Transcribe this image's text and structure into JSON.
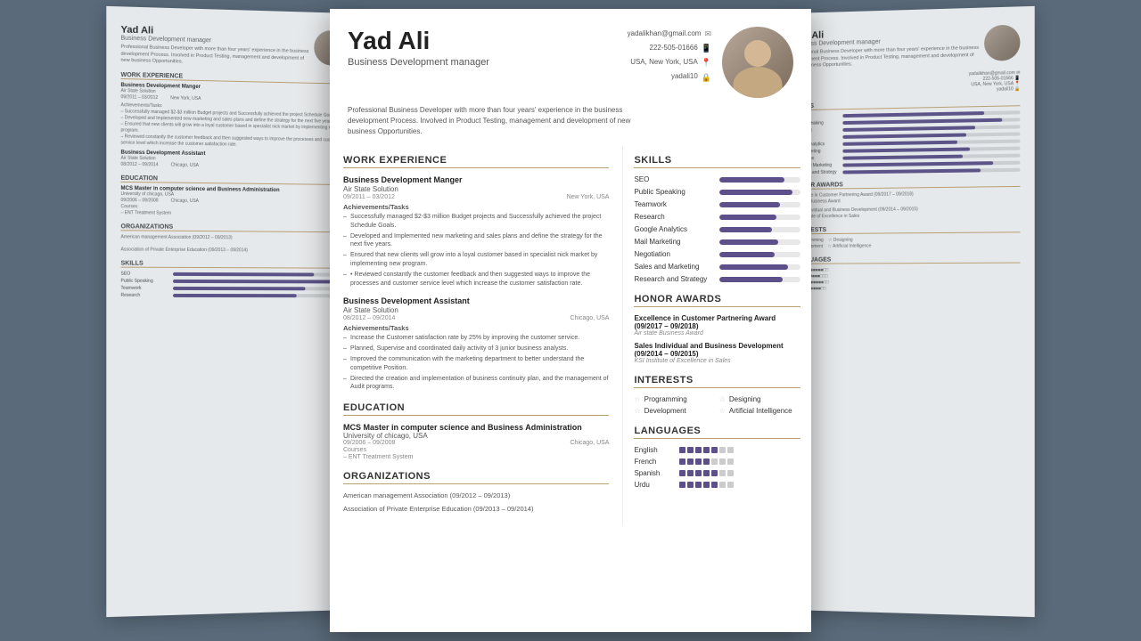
{
  "person": {
    "name": "Yad Ali",
    "title": "Business Development manager",
    "bio": "Professional Business Developer with more than four years' experience in the business development Process. Involved in Product Testing, management and development of new business Opportunities.",
    "contact": {
      "email": "yadalikhan@gmail.com",
      "phone": "222-505-01666",
      "location": "USA, New York, USA",
      "social": "yadali10"
    }
  },
  "workExperience": {
    "sectionTitle": "WORK EXPERIENCE",
    "jobs": [
      {
        "title": "Business Development Manger",
        "company": "Air State Solution",
        "dates": "09/2011 – 03/2012",
        "location": "New York, USA",
        "achievementsLabel": "Achievements/Tasks",
        "bullets": [
          "Successfully managed $2-$3 million Budget projects and Successfully achieved the project Schedule Goals.",
          "Developed and Implemented new marketing and sales plans and define the strategy for the next five years.",
          "Ensured that new clients will grow into a loyal customer based in specialist nick market by implementing new program.",
          "• Reviewed constantly the customer feedback and then suggested ways to improve the processes and customer service level which increase the customer satisfaction rate."
        ]
      },
      {
        "title": "Business Development Assistant",
        "company": "Air State Solution",
        "dates": "08/2012 – 09/2014",
        "location": "Chicago, USA",
        "achievementsLabel": "Achievements/Tasks",
        "bullets": [
          "Increase the Customer satisfaction rate by 25% by improving the customer service.",
          "Planned, Supervise and coordinated daily activity of 3 junior business analysts.",
          "Improved the communication with the marketing department to better understand the competitive Position.",
          "Directed the creation and implementation of business continuity plan, and the management of Audit programs."
        ]
      }
    ]
  },
  "education": {
    "sectionTitle": "EDUCATION",
    "entries": [
      {
        "degree": "MCS Master in computer science and Business Administration",
        "school": "University of chicago, USA",
        "dates": "09/2006 – 09/2008",
        "location": "Chicago, USA",
        "courseLabel": "Courses",
        "course": "– ENT Treatment System"
      }
    ]
  },
  "organizations": {
    "sectionTitle": "ORGANIZATIONS",
    "entries": [
      "American management Association (09/2012 – 09/2013)",
      "Association of Private Enterprise Education (09/2013 – 09/2014)"
    ]
  },
  "skills": {
    "sectionTitle": "SKILLS",
    "items": [
      {
        "name": "SEO",
        "percent": 80
      },
      {
        "name": "Public Speaking",
        "percent": 90
      },
      {
        "name": "Teamwork",
        "percent": 75
      },
      {
        "name": "Research",
        "percent": 70
      },
      {
        "name": "Google Analytics",
        "percent": 65
      },
      {
        "name": "Mail Marketing",
        "percent": 72
      },
      {
        "name": "Negotiation",
        "percent": 68
      },
      {
        "name": "Sales and Marketing",
        "percent": 85
      },
      {
        "name": "Research and Strategy",
        "percent": 78
      }
    ]
  },
  "honorAwards": {
    "sectionTitle": "HONOR AWARDS",
    "entries": [
      {
        "title": "Excellence in Customer Partnering Award (09/2017 – 09/2018)",
        "sub": "Air state Business Award"
      },
      {
        "title": "Sales Individual and Business Development (09/2014 – 09/2015)",
        "sub": "KSI Institute of Excellence in Sales"
      }
    ]
  },
  "interests": {
    "sectionTitle": "INTERESTS",
    "items": [
      "Programming",
      "Designing",
      "Development",
      "Artificial Intelligence"
    ]
  },
  "languages": {
    "sectionTitle": "LANGUAGES",
    "items": [
      {
        "name": "English",
        "filled": 5,
        "total": 7
      },
      {
        "name": "French",
        "filled": 4,
        "total": 7
      },
      {
        "name": "Spanish",
        "filled": 5,
        "total": 7
      },
      {
        "name": "Urdu",
        "filled": 5,
        "total": 7
      }
    ]
  }
}
